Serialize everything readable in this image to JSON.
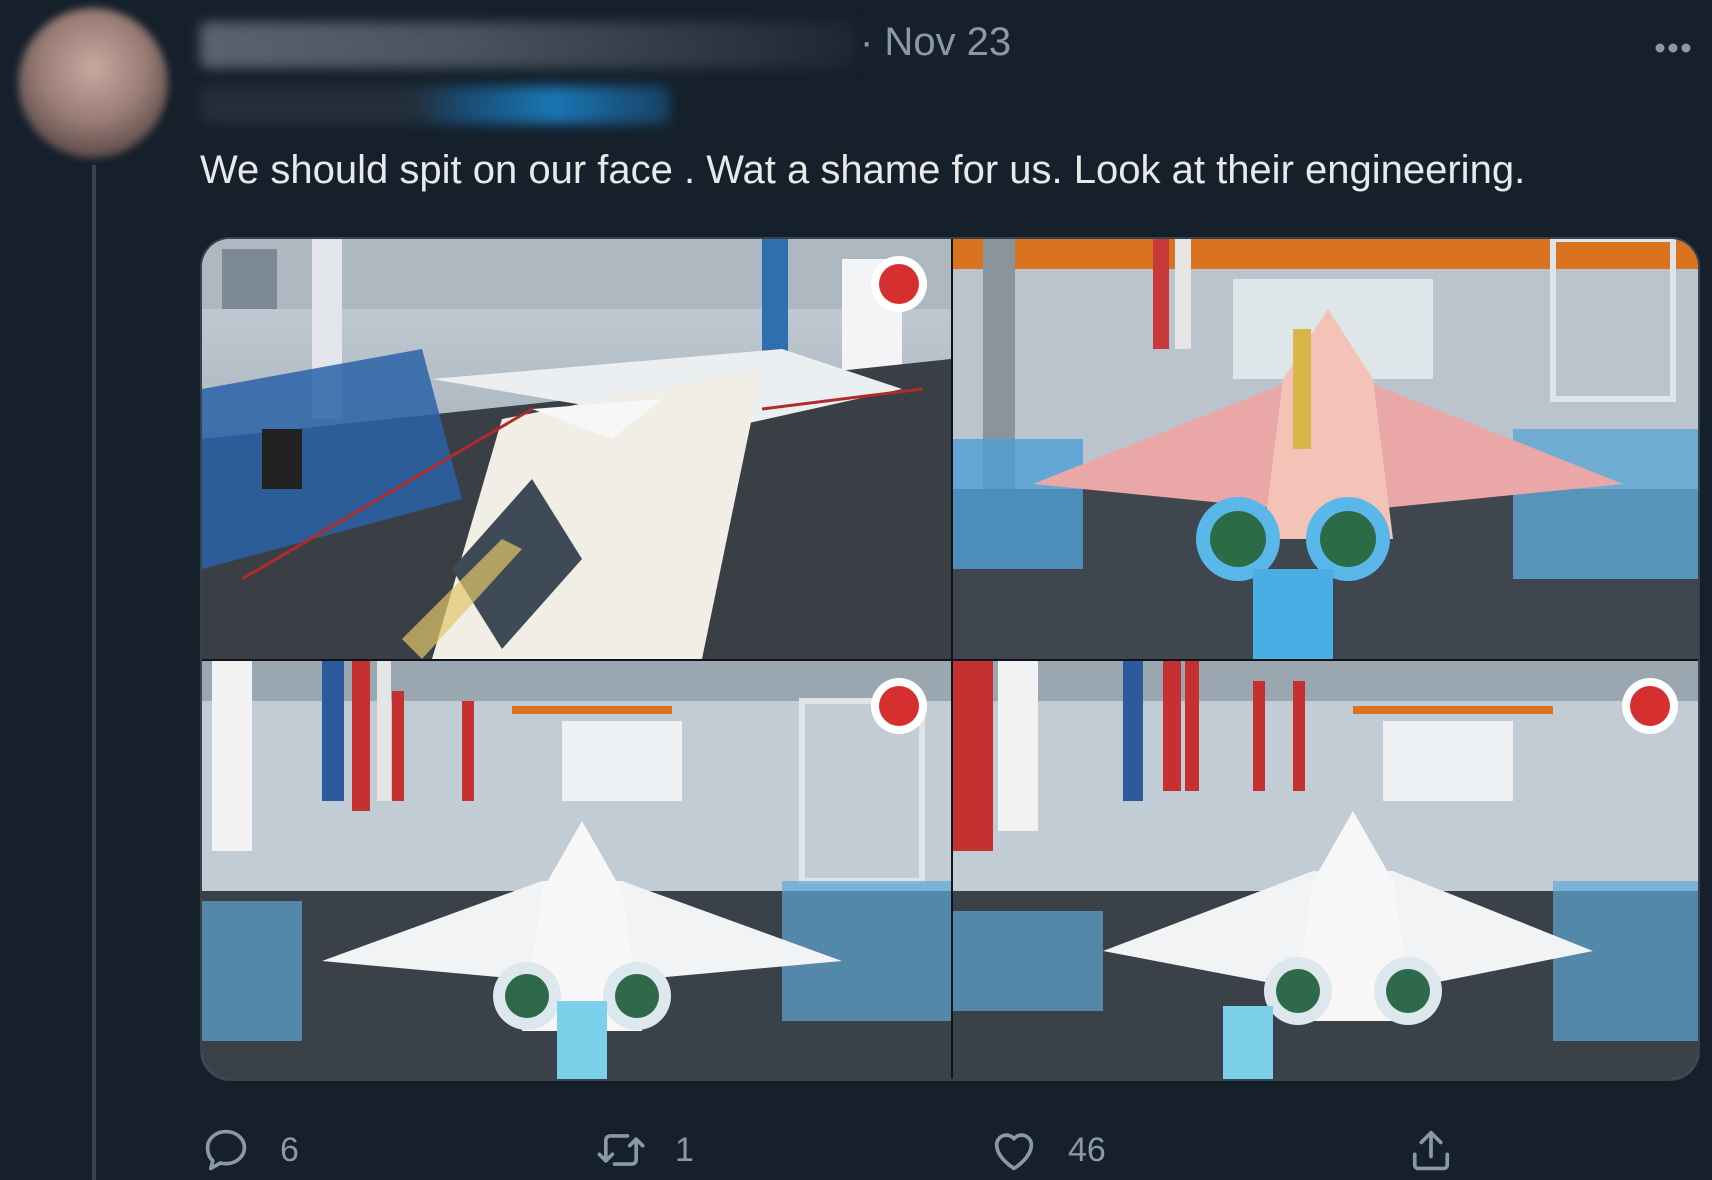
{
  "tweet": {
    "timestamp": "· Nov 23",
    "text": "We should spit on our face . Wat a shame for us. Look at their engineering."
  },
  "actions": {
    "reply_count": "6",
    "retweet_count": "1",
    "like_count": "46"
  },
  "icons": {
    "more": "more-horizontal-icon",
    "reply": "reply-icon",
    "retweet": "retweet-icon",
    "like": "heart-icon",
    "share": "share-icon"
  },
  "colors": {
    "background": "#15202b",
    "text": "#e7e9ea",
    "muted": "#8b98a5",
    "divider": "#38444d"
  }
}
